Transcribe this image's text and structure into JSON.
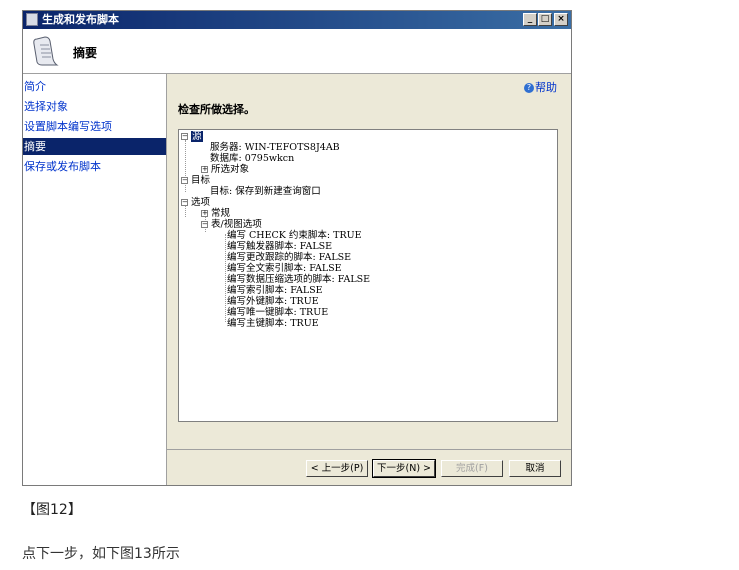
{
  "window": {
    "title": "生成和发布脚本",
    "controls": {
      "minimize": "_",
      "maximize": "□",
      "close": "×"
    }
  },
  "header": {
    "title": "摘要",
    "icon": "script-scroll-icon"
  },
  "sidebar": {
    "items": [
      {
        "label": "简介",
        "active": false
      },
      {
        "label": "选择对象",
        "active": false
      },
      {
        "label": "设置脚本编写选项",
        "active": false
      },
      {
        "label": "摘要",
        "active": true
      },
      {
        "label": "保存或发布脚本",
        "active": false
      }
    ]
  },
  "help": {
    "label": "帮助",
    "icon": "help-icon"
  },
  "main": {
    "section_title": "检查所做选择。",
    "tree": [
      {
        "text": "源",
        "expander": "-",
        "selected": true
      },
      {
        "text": "服务器: WIN-TEFOTS8J4AB",
        "expander": ""
      },
      {
        "text": "数据库: 0795wkcn",
        "expander": ""
      },
      {
        "text": "所选对象",
        "expander": "+"
      },
      {
        "text": "目标",
        "expander": "-"
      },
      {
        "text": "目标: 保存到新建查询窗口",
        "expander": ""
      },
      {
        "text": "选项",
        "expander": "-"
      },
      {
        "text": "常规",
        "expander": "+"
      },
      {
        "text": "表/视图选项",
        "expander": "-"
      },
      {
        "text": "编写 CHECK 约束脚本: TRUE",
        "expander": ""
      },
      {
        "text": "编写触发器脚本: FALSE",
        "expander": ""
      },
      {
        "text": "编写更改跟踪的脚本: FALSE",
        "expander": ""
      },
      {
        "text": "编写全文索引脚本: FALSE",
        "expander": ""
      },
      {
        "text": "编写数据压缩选项的脚本: FALSE",
        "expander": ""
      },
      {
        "text": "编写索引脚本: FALSE",
        "expander": ""
      },
      {
        "text": "编写外键脚本: TRUE",
        "expander": ""
      },
      {
        "text": "编写唯一键脚本: TRUE",
        "expander": ""
      },
      {
        "text": "编写主键脚本: TRUE",
        "expander": ""
      }
    ]
  },
  "buttons": {
    "prev": "< 上一步(P)",
    "next": "下一步(N) >",
    "finish": "完成(F)",
    "cancel": "取消"
  },
  "caption": "【图12】",
  "body_text": "点下一步，如下图13所示"
}
